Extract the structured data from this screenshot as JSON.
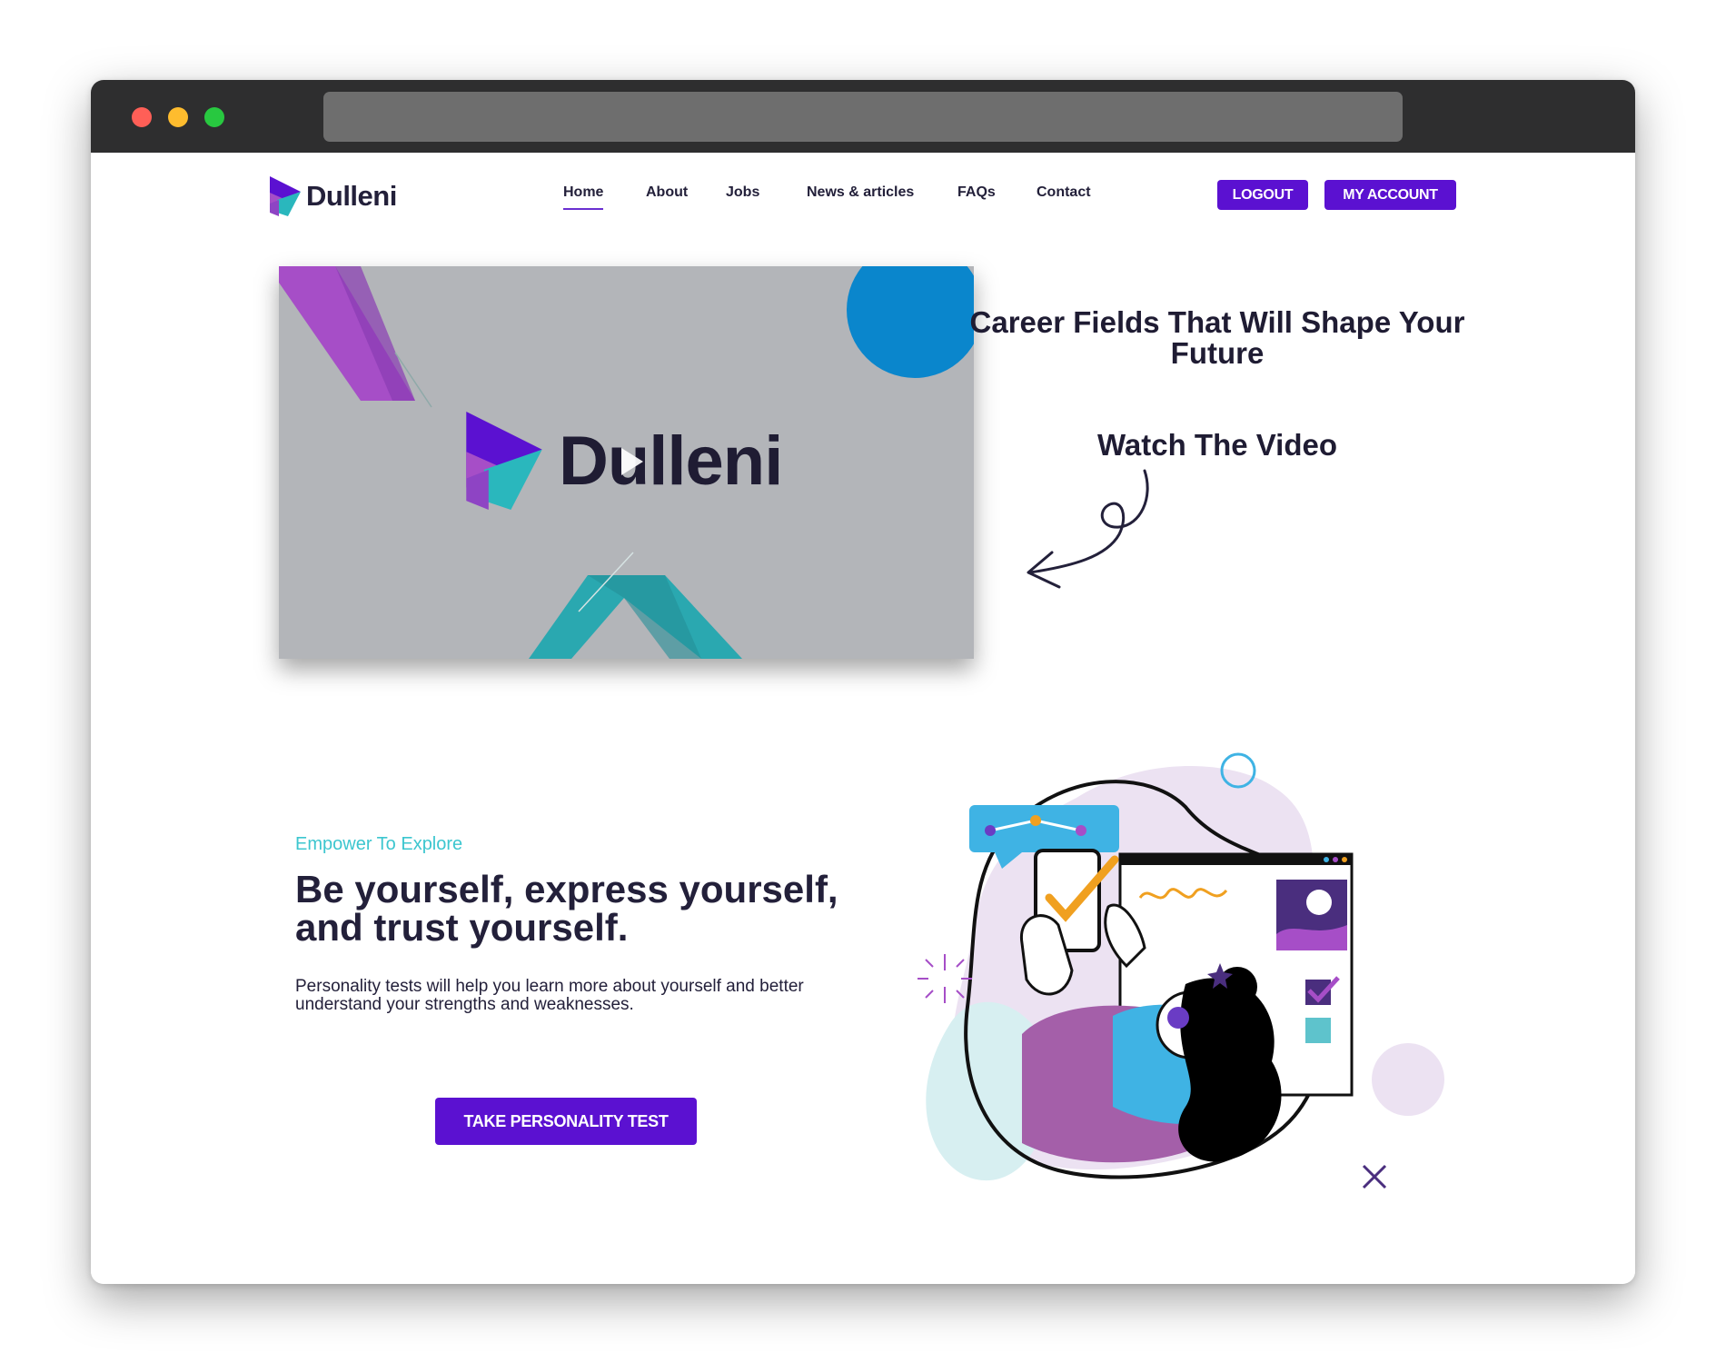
{
  "brand": {
    "name": "Dulleni"
  },
  "nav": {
    "items": [
      {
        "label": "Home",
        "active": true
      },
      {
        "label": "About"
      },
      {
        "label": "Jobs"
      },
      {
        "label": "News & articles"
      },
      {
        "label": "FAQs"
      },
      {
        "label": "Contact"
      }
    ]
  },
  "header_buttons": {
    "logout": "LOGOUT",
    "account": "MY ACCOUNT"
  },
  "video": {
    "brand_text": "Dulleni"
  },
  "hero": {
    "title": "Career Fields That Will Shape Your Future",
    "watch": "Watch The Video"
  },
  "section": {
    "eyebrow": "Empower To Explore",
    "headline": "Be yourself, express yourself, and trust yourself.",
    "body": "Personality tests will help you learn more about yourself and better understand your strengths and weaknesses.",
    "cta": "TAKE PERSONALITY TEST"
  },
  "colors": {
    "accent": "#5b11d1",
    "teal": "#3cc6cf",
    "dark": "#23203a"
  }
}
